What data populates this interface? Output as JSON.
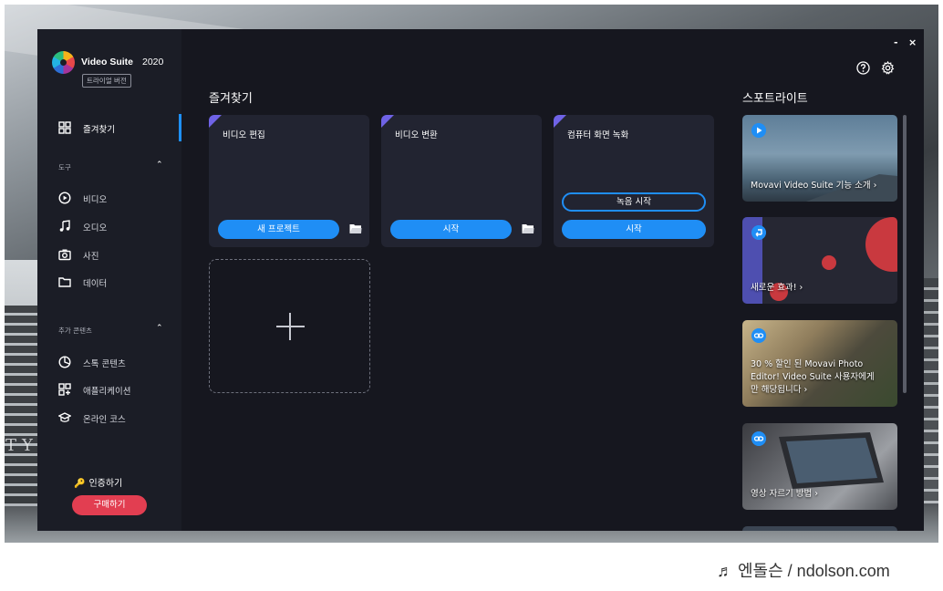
{
  "window": {
    "minimize": "-",
    "close": "×"
  },
  "app": {
    "name": "Video Suite",
    "year": "2020",
    "trial_badge": "트라이얼 버전"
  },
  "sidebar": {
    "favorites": "즐겨찾기",
    "tools_header": "도구",
    "tools": [
      "비디오",
      "오디오",
      "사진",
      "데이터"
    ],
    "extra_header": "추가 콘텐츠",
    "extras": [
      "스톡 콘텐츠",
      "애플리케이션",
      "온라인 코스"
    ],
    "activate": "인증하기",
    "buy": "구매하기"
  },
  "main": {
    "title": "즐겨찾기",
    "cards": [
      {
        "title": "비디오 편집",
        "button": "새 프로젝트"
      },
      {
        "title": "비디오 변환",
        "button": "시작"
      },
      {
        "title": "컴퓨터 화면 녹화",
        "button_outline": "녹음 시작",
        "button": "시작"
      }
    ]
  },
  "spotlight": {
    "title": "스포트라이트",
    "items": [
      {
        "text": "Movavi Video Suite 기능 소개 ›",
        "icon": "play-icon"
      },
      {
        "text": "새로운 효과! ›",
        "icon": "return-icon"
      },
      {
        "text_lines": [
          "30 % 할인 된 Movavi Photo",
          "Editor! Video Suite 사용자에게",
          "만 해당됩니다 ›"
        ],
        "icon": "link-icon"
      },
      {
        "text": "영상 자르기 방법 ›",
        "icon": "link-icon"
      }
    ]
  },
  "background": {
    "plate_text": "TY CAR"
  },
  "watermark": "♬ 엔돌슨 / ndolson.com",
  "colors": {
    "accent": "#1f8ef5",
    "buy": "#e23e51",
    "window_bg": "#16171f",
    "sidebar_bg": "#1b1d26",
    "card_bg": "#222431",
    "corner": "#6f63e6"
  }
}
